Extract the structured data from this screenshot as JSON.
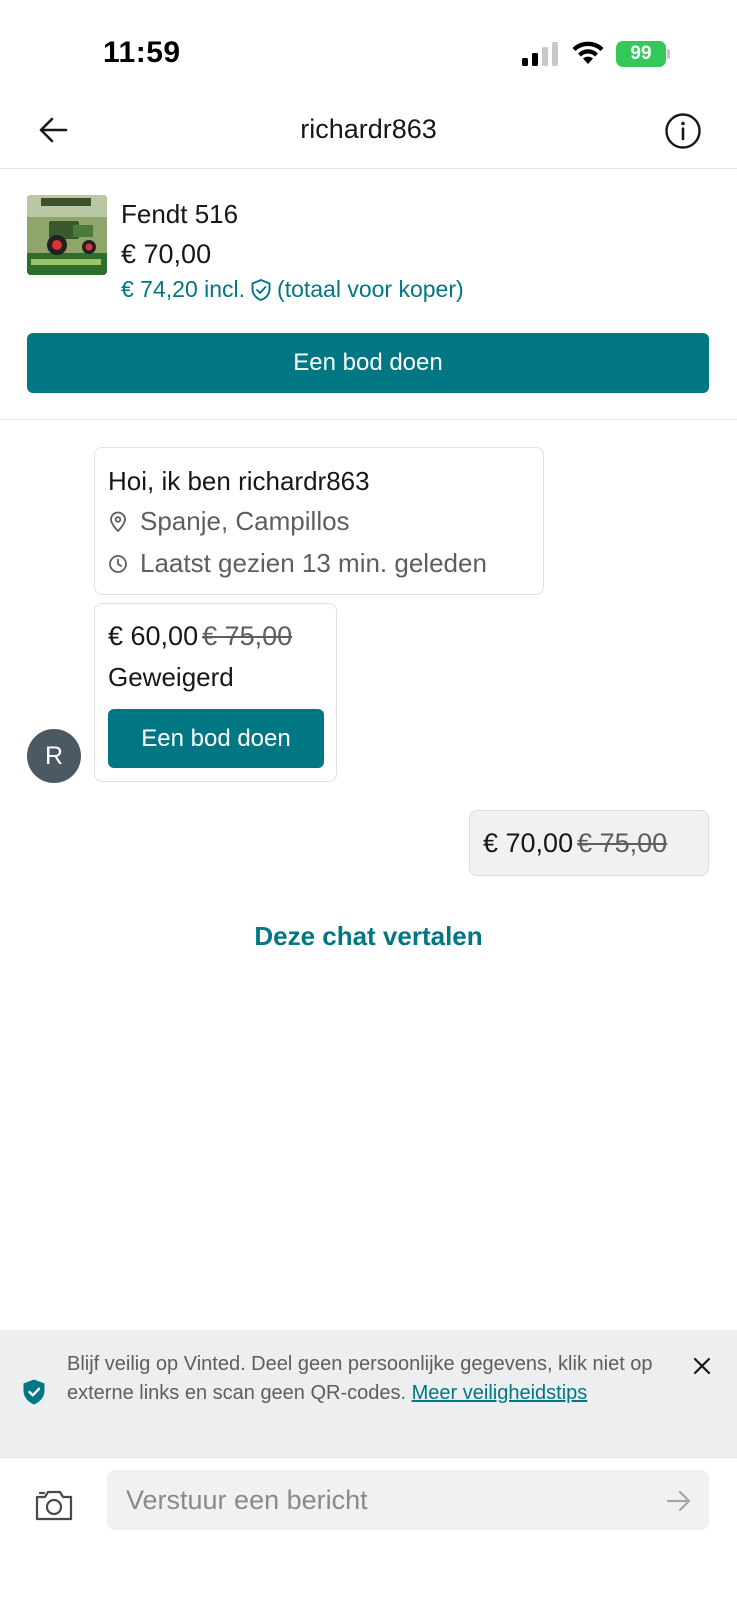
{
  "status_bar": {
    "time": "11:59",
    "battery": "99"
  },
  "nav": {
    "title": "richardr863",
    "back_icon": "arrow-left-icon",
    "info_icon": "info-circle-icon"
  },
  "item": {
    "title": "Fendt 516",
    "price": "€ 70,00",
    "total_prefix": "€ 74,20 incl.",
    "total_suffix": "(totaal voor koper)",
    "offer_button": "Een bod doen"
  },
  "intro": {
    "title": "Hoi, ik ben richardr863",
    "location": "Spanje, Campillos",
    "last_seen": "Laatst gezien 13 min. geleden"
  },
  "offer": {
    "price": "€ 60,00",
    "original_price": "€ 75,00",
    "status": "Geweigerd",
    "button": "Een bod doen"
  },
  "avatar": {
    "initial": "R"
  },
  "my_offer": {
    "price": "€ 70,00",
    "original_price": "€ 75,00"
  },
  "translate_link": "Deze chat vertalen",
  "safety": {
    "text": "Blijf veilig op Vinted. Deel geen persoonlijke gegevens, klik niet op externe links en scan geen QR-codes. ",
    "link": "Meer veiligheidstips"
  },
  "composer": {
    "placeholder": "Verstuur een bericht"
  },
  "colors": {
    "accent": "#007782",
    "battery": "#34c759",
    "avatar": "#4b5a62"
  }
}
